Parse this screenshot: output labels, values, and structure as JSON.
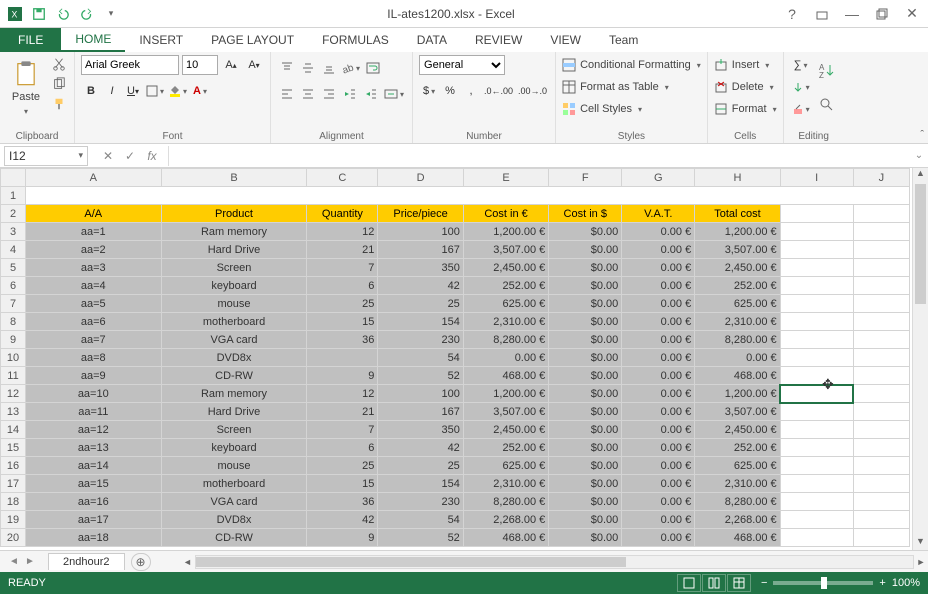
{
  "window": {
    "title": "IL-ates1200.xlsx - Excel"
  },
  "tabs": {
    "file": "FILE",
    "home": "HOME",
    "insert": "INSERT",
    "pagelayout": "PAGE LAYOUT",
    "formulas": "FORMULAS",
    "data": "DATA",
    "review": "REVIEW",
    "view": "VIEW",
    "team": "Team"
  },
  "ribbon": {
    "clipboard": {
      "paste": "Paste",
      "label": "Clipboard"
    },
    "font": {
      "name": "Arial Greek",
      "size": "10",
      "label": "Font"
    },
    "alignment": {
      "label": "Alignment"
    },
    "number": {
      "format": "General",
      "label": "Number"
    },
    "styles": {
      "cf": "Conditional Formatting",
      "table": "Format as Table",
      "cell": "Cell Styles",
      "label": "Styles"
    },
    "cells": {
      "insert": "Insert",
      "delete": "Delete",
      "format": "Format",
      "label": "Cells"
    },
    "editing": {
      "label": "Editing"
    }
  },
  "formula_bar": {
    "name_box": "I12",
    "fx": "fx"
  },
  "sheet": {
    "cols": [
      "A",
      "B",
      "C",
      "D",
      "E",
      "F",
      "G",
      "H",
      "I",
      "J"
    ],
    "header_row": [
      "A/A",
      "Product",
      "Quantity",
      "Price/piece",
      "Cost in €",
      "Cost in $",
      "V.A.T.",
      "Total cost"
    ],
    "rows": [
      {
        "n": 3,
        "aa": "aa=1",
        "prod": "Ram memory",
        "qty": "12",
        "price": "100",
        "costE": "1,200.00 €",
        "costD": "$0.00",
        "vat": "0.00 €",
        "tot": "1,200.00 €"
      },
      {
        "n": 4,
        "aa": "aa=2",
        "prod": "Hard Drive",
        "qty": "21",
        "price": "167",
        "costE": "3,507.00 €",
        "costD": "$0.00",
        "vat": "0.00 €",
        "tot": "3,507.00 €"
      },
      {
        "n": 5,
        "aa": "aa=3",
        "prod": "Screen",
        "qty": "7",
        "price": "350",
        "costE": "2,450.00 €",
        "costD": "$0.00",
        "vat": "0.00 €",
        "tot": "2,450.00 €"
      },
      {
        "n": 6,
        "aa": "aa=4",
        "prod": "keyboard",
        "qty": "6",
        "price": "42",
        "costE": "252.00 €",
        "costD": "$0.00",
        "vat": "0.00 €",
        "tot": "252.00 €"
      },
      {
        "n": 7,
        "aa": "aa=5",
        "prod": "mouse",
        "qty": "25",
        "price": "25",
        "costE": "625.00 €",
        "costD": "$0.00",
        "vat": "0.00 €",
        "tot": "625.00 €"
      },
      {
        "n": 8,
        "aa": "aa=6",
        "prod": "motherboard",
        "qty": "15",
        "price": "154",
        "costE": "2,310.00 €",
        "costD": "$0.00",
        "vat": "0.00 €",
        "tot": "2,310.00 €"
      },
      {
        "n": 9,
        "aa": "aa=7",
        "prod": "VGA card",
        "qty": "36",
        "price": "230",
        "costE": "8,280.00 €",
        "costD": "$0.00",
        "vat": "0.00 €",
        "tot": "8,280.00 €"
      },
      {
        "n": 10,
        "aa": "aa=8",
        "prod": "DVD8x",
        "qty": "",
        "price": "54",
        "costE": "0.00 €",
        "costD": "$0.00",
        "vat": "0.00 €",
        "tot": "0.00 €"
      },
      {
        "n": 11,
        "aa": "aa=9",
        "prod": "CD-RW",
        "qty": "9",
        "price": "52",
        "costE": "468.00 €",
        "costD": "$0.00",
        "vat": "0.00 €",
        "tot": "468.00 €"
      },
      {
        "n": 12,
        "aa": "aa=10",
        "prod": "Ram memory",
        "qty": "12",
        "price": "100",
        "costE": "1,200.00 €",
        "costD": "$0.00",
        "vat": "0.00 €",
        "tot": "1,200.00 €"
      },
      {
        "n": 13,
        "aa": "aa=11",
        "prod": "Hard Drive",
        "qty": "21",
        "price": "167",
        "costE": "3,507.00 €",
        "costD": "$0.00",
        "vat": "0.00 €",
        "tot": "3,507.00 €"
      },
      {
        "n": 14,
        "aa": "aa=12",
        "prod": "Screen",
        "qty": "7",
        "price": "350",
        "costE": "2,450.00 €",
        "costD": "$0.00",
        "vat": "0.00 €",
        "tot": "2,450.00 €"
      },
      {
        "n": 15,
        "aa": "aa=13",
        "prod": "keyboard",
        "qty": "6",
        "price": "42",
        "costE": "252.00 €",
        "costD": "$0.00",
        "vat": "0.00 €",
        "tot": "252.00 €"
      },
      {
        "n": 16,
        "aa": "aa=14",
        "prod": "mouse",
        "qty": "25",
        "price": "25",
        "costE": "625.00 €",
        "costD": "$0.00",
        "vat": "0.00 €",
        "tot": "625.00 €"
      },
      {
        "n": 17,
        "aa": "aa=15",
        "prod": "motherboard",
        "qty": "15",
        "price": "154",
        "costE": "2,310.00 €",
        "costD": "$0.00",
        "vat": "0.00 €",
        "tot": "2,310.00 €"
      },
      {
        "n": 18,
        "aa": "aa=16",
        "prod": "VGA card",
        "qty": "36",
        "price": "230",
        "costE": "8,280.00 €",
        "costD": "$0.00",
        "vat": "0.00 €",
        "tot": "8,280.00 €"
      },
      {
        "n": 19,
        "aa": "aa=17",
        "prod": "DVD8x",
        "qty": "42",
        "price": "54",
        "costE": "2,268.00 €",
        "costD": "$0.00",
        "vat": "0.00 €",
        "tot": "2,268.00 €"
      },
      {
        "n": 20,
        "aa": "aa=18",
        "prod": "CD-RW",
        "qty": "9",
        "price": "52",
        "costE": "468.00 €",
        "costD": "$0.00",
        "vat": "0.00 €",
        "tot": "468.00 €"
      }
    ]
  },
  "sheet_tabs": {
    "active": "2ndhour2"
  },
  "status": {
    "ready": "READY",
    "zoom": "100%"
  }
}
